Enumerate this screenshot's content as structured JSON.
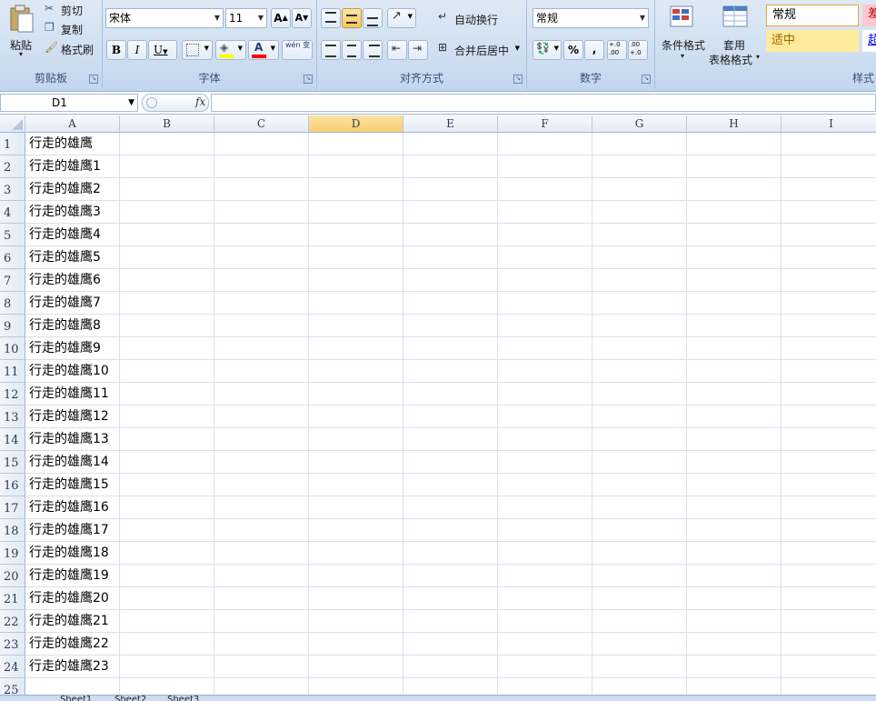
{
  "ribbon": {
    "clipboard": {
      "group_label": "剪贴板",
      "paste": "粘贴",
      "cut": "剪切",
      "copy": "复制",
      "format_painter": "格式刷"
    },
    "font": {
      "group_label": "字体",
      "font_name": "宋体",
      "font_size": "11",
      "bold": "B",
      "italic": "I",
      "underline": "U",
      "font_color_glyph": "A",
      "phonetic": "wén 变",
      "grow": "A",
      "shrink": "A"
    },
    "alignment": {
      "group_label": "对齐方式",
      "wrap_text": "自动换行",
      "merge_center": "合并后居中"
    },
    "number": {
      "group_label": "数字",
      "format": "常规",
      "percent": "%",
      "comma": ",",
      "inc_decimal": "+.0 .00",
      "dec_decimal": ".00 +.0"
    },
    "styles": {
      "group_label": "样式",
      "conditional_format": "条件格式",
      "format_table_line1": "套用",
      "format_table_line2": "表格格式",
      "style_normal": "常规",
      "style_neutral": "适中",
      "style_bad": "差",
      "style_hyperlink": "超"
    }
  },
  "formula_bar": {
    "name_box": "D1",
    "fx": "fx",
    "formula": ""
  },
  "sheet": {
    "columns": [
      "A",
      "B",
      "C",
      "D",
      "E",
      "F",
      "G",
      "H",
      "I"
    ],
    "selected_column": "D",
    "rows": [
      {
        "n": "1",
        "a": "行走的雄鹰"
      },
      {
        "n": "2",
        "a": "行走的雄鹰1"
      },
      {
        "n": "3",
        "a": "行走的雄鹰2"
      },
      {
        "n": "4",
        "a": "行走的雄鹰3"
      },
      {
        "n": "5",
        "a": "行走的雄鹰4"
      },
      {
        "n": "6",
        "a": "行走的雄鹰5"
      },
      {
        "n": "7",
        "a": "行走的雄鹰6"
      },
      {
        "n": "8",
        "a": "行走的雄鹰7"
      },
      {
        "n": "9",
        "a": "行走的雄鹰8"
      },
      {
        "n": "10",
        "a": "行走的雄鹰9"
      },
      {
        "n": "11",
        "a": "行走的雄鹰10"
      },
      {
        "n": "12",
        "a": "行走的雄鹰11"
      },
      {
        "n": "13",
        "a": "行走的雄鹰12"
      },
      {
        "n": "14",
        "a": "行走的雄鹰13"
      },
      {
        "n": "15",
        "a": "行走的雄鹰14"
      },
      {
        "n": "16",
        "a": "行走的雄鹰15"
      },
      {
        "n": "17",
        "a": "行走的雄鹰16"
      },
      {
        "n": "18",
        "a": "行走的雄鹰17"
      },
      {
        "n": "19",
        "a": "行走的雄鹰18"
      },
      {
        "n": "20",
        "a": "行走的雄鹰19"
      },
      {
        "n": "21",
        "a": "行走的雄鹰20"
      },
      {
        "n": "22",
        "a": "行走的雄鹰21"
      },
      {
        "n": "23",
        "a": "行走的雄鹰22"
      },
      {
        "n": "24",
        "a": "行走的雄鹰23"
      },
      {
        "n": "25",
        "a": ""
      }
    ]
  },
  "sheet_tabs": [
    "Sheet1",
    "Sheet2",
    "Sheet3"
  ],
  "colors": {
    "ribbon_bg": "#cfdff1",
    "selected_header": "#f8cf72",
    "style_neutral_bg": "#ffeb9c",
    "style_bad": "#c00000",
    "font_color_bar": "#ff0000",
    "highlight_bar": "#ffff00"
  }
}
